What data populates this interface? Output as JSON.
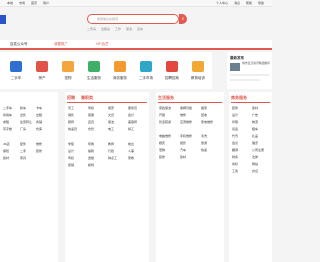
{
  "topbar": {
    "left": [
      "本地",
      "市场",
      "首页",
      "用户"
    ],
    "right": [
      "个人中心",
      "消息",
      "帮助",
      "导航"
    ]
  },
  "search": {
    "placeholder": "搜索信息关键词",
    "button_icon": "search-icon"
  },
  "hotkeys": [
    "二手房",
    "出租房",
    "工作",
    "保洁",
    "货车"
  ],
  "nav": {
    "city": "百姓公众号",
    "center": "我要推广",
    "right": "VIP会员"
  },
  "categories": [
    {
      "label": "二手车",
      "sub": "二手车 新车",
      "color": "#2f6fd1",
      "icon": "car-icon"
    },
    {
      "label": "房产",
      "sub": "出租 出售",
      "color": "#e0544a",
      "icon": "house-icon"
    },
    {
      "label": "宠物",
      "sub": "狗 猫",
      "color": "#f3a63b",
      "icon": "pet-icon"
    },
    {
      "label": "生活服务",
      "sub": "家政 维修",
      "color": "#3fb067",
      "icon": "service-icon"
    },
    {
      "label": "商务服务",
      "sub": "装修 物流",
      "color": "#f29a2e",
      "icon": "business-icon"
    },
    {
      "label": "二手市场",
      "sub": "手机 家电",
      "color": "#2fa7c9",
      "icon": "market-icon"
    },
    {
      "label": "招聘招商",
      "sub": "全职 兼职",
      "color": "#e2483d",
      "icon": "job-icon"
    },
    {
      "label": "教育培训",
      "sub": "学历 技能",
      "color": "#f1a935",
      "icon": "education-icon"
    }
  ],
  "news": {
    "title": "最新发布",
    "item": "城市生活资讯精选推荐"
  },
  "columns": [
    {
      "head": "",
      "items": [
        "二手车",
        "新车",
        "卡车",
        "商用车",
        "出售",
        "出租",
        "求租",
        "生意转让",
        "商铺",
        "写字楼",
        "厂房",
        "仓库",
        "4S店",
        "配件",
        "维修",
        "保险",
        "二手",
        "装修",
        "建材",
        "家具"
      ]
    },
    {
      "head": "招聘",
      "head2": "兼职类",
      "items": [
        "普工",
        "司机",
        "保安",
        "服务员",
        "销售",
        "客服",
        "文员",
        "会计",
        "厨师",
        "店员",
        "保洁",
        "美容师",
        "快递员",
        "仓管",
        "电工",
        "焊工",
        "学徒",
        "导购",
        "教师",
        "前台",
        "设计",
        "编辑",
        "行政",
        "人事",
        "司机",
        "送餐",
        "钟点工",
        "家教",
        "促销",
        "模特"
      ]
    },
    {
      "head": "生活服务",
      "items": [
        "家政保洁",
        "保姆月嫂",
        "搬家",
        "开锁",
        "维修",
        "回收",
        "管道疏通",
        "空调维修",
        "家电维修",
        "电脑维修",
        "手机维修",
        "清洗",
        "婚庆",
        "摄影",
        "旅游",
        "宠物",
        "汽车",
        "快递",
        "装修",
        "建材"
      ]
    },
    {
      "head": "商务服务",
      "items": [
        "装修",
        "建材",
        "设计",
        "广告",
        "印刷",
        "物流",
        "货运",
        "租车",
        "代驾",
        "礼品",
        "会议",
        "展览",
        "翻译",
        "公司注册",
        "财务",
        "法律",
        "商标",
        "网站",
        "工商",
        "办证"
      ]
    }
  ]
}
